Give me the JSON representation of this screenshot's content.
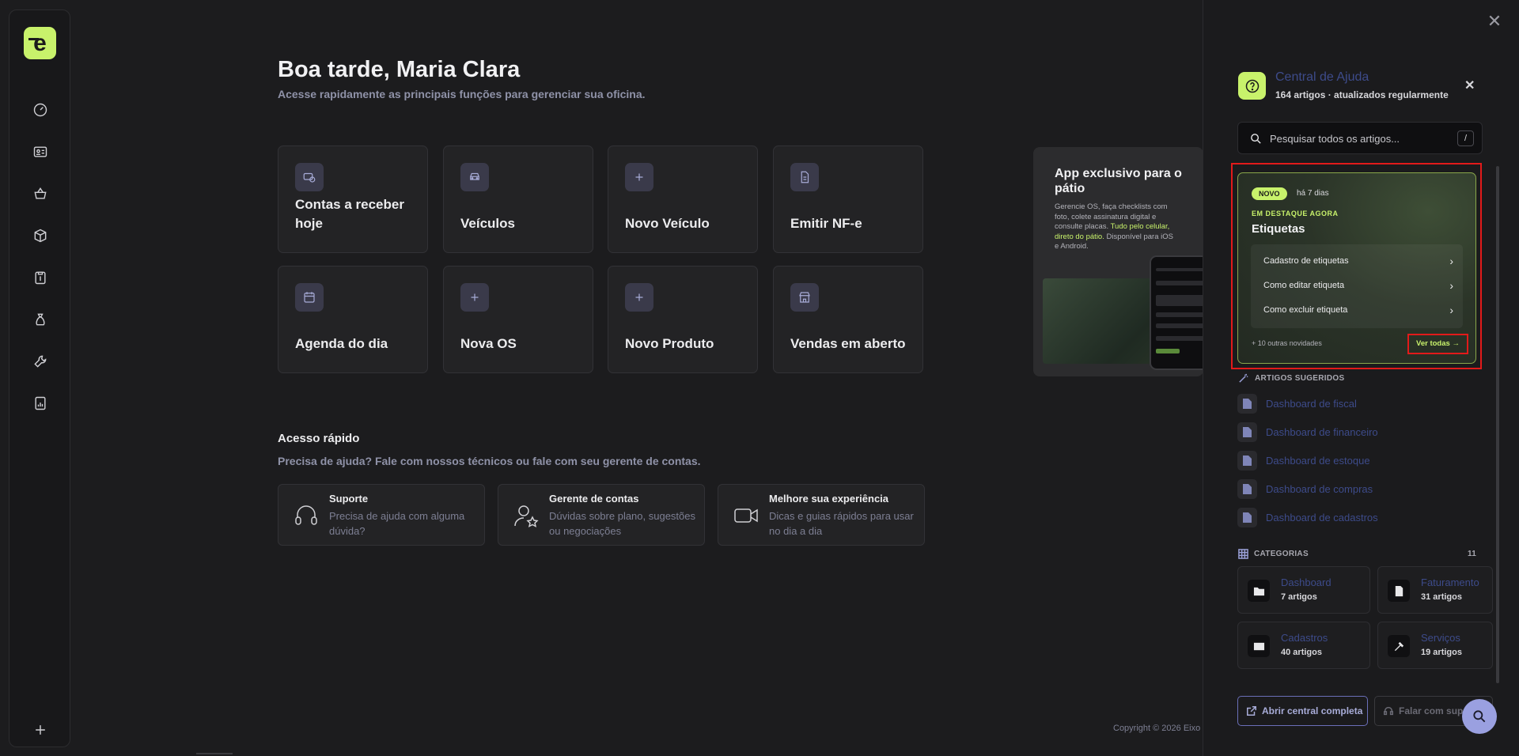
{
  "greeting": {
    "title": "Boa tarde, Maria Clara",
    "subtitle": "Acesse rapidamente as principais funções para gerenciar sua oficina."
  },
  "tiles": [
    {
      "label": "Contas a receber hoje",
      "icon": "money-receive-icon"
    },
    {
      "label": "Veículos",
      "icon": "car-icon"
    },
    {
      "label": "Novo Veículo",
      "icon": "plus-icon"
    },
    {
      "label": "Emitir NF-e",
      "icon": "document-icon"
    },
    {
      "label": "Agenda do dia",
      "icon": "calendar-icon"
    },
    {
      "label": "Nova OS",
      "icon": "plus-icon"
    },
    {
      "label": "Novo Produto",
      "icon": "plus-icon"
    },
    {
      "label": "Vendas em aberto",
      "icon": "store-icon"
    }
  ],
  "promo": {
    "title": "App exclusivo para o pátio",
    "text_a": "Gerencie OS, faça checklists com foto, colete assinatura digital e consulte placas.",
    "text_highlight": "Tudo pelo celular, direto do pátio.",
    "text_b": "Disponível para iOS e Android."
  },
  "quick_access": {
    "title": "Acesso rápido",
    "subtitle": "Precisa de ajuda? Fale com nossos técnicos ou fale com seu gerente de contas.",
    "cards": [
      {
        "title": "Suporte",
        "desc": "Precisa de ajuda com alguma dúvida?",
        "icon": "headset-icon"
      },
      {
        "title": "Gerente de contas",
        "desc": "Dúvidas sobre plano, sugestões ou negociações",
        "icon": "user-star-icon"
      },
      {
        "title": "Melhore sua experiência",
        "desc": "Dicas e guias rápidos para usar no dia a dia",
        "icon": "video-icon"
      }
    ]
  },
  "copyright": "Copyright © 2026 Eixo",
  "help": {
    "title": "Central de Ajuda",
    "subtitle": "164 artigos · atualizados regularmente",
    "search_placeholder": "Pesquisar todos os artigos...",
    "search_shortcut": "/",
    "featured": {
      "badge": "NOVO",
      "time": "há 7 dias",
      "kicker": "EM DESTAQUE AGORA",
      "title": "Etiquetas",
      "items": [
        "Cadastro de etiquetas",
        "Como editar etiqueta",
        "Como excluir etiqueta"
      ],
      "more": "+ 10 outras novidades",
      "see_all": "Ver todas →"
    },
    "suggested_title": "ARTIGOS SUGERIDOS",
    "suggested": [
      "Dashboard de fiscal",
      "Dashboard de financeiro",
      "Dashboard de estoque",
      "Dashboard de compras",
      "Dashboard de cadastros"
    ],
    "categories_title": "CATEGORIAS",
    "categories_count": "11",
    "categories": [
      {
        "name": "Dashboard",
        "count": "7 artigos",
        "icon": "folder-icon"
      },
      {
        "name": "Faturamento",
        "count": "31 artigos",
        "icon": "invoice-icon"
      },
      {
        "name": "Cadastros",
        "count": "40 artigos",
        "icon": "id-card-icon"
      },
      {
        "name": "Serviços",
        "count": "19 artigos",
        "icon": "tools-icon"
      }
    ],
    "open_full": "Abrir central completa",
    "talk_support": "Falar com suporte"
  }
}
